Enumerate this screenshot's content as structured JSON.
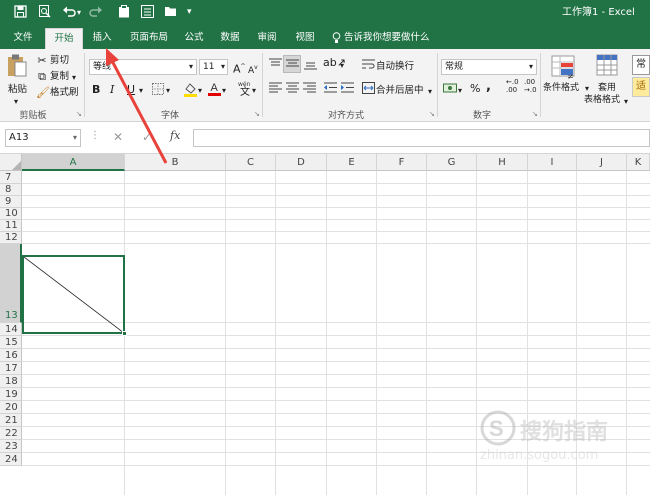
{
  "window": {
    "title": "工作簿1 - Excel"
  },
  "quick_access": {
    "save_icon": "save-icon",
    "print_preview_icon": "print-preview-icon",
    "undo_icon": "undo-icon",
    "redo_icon": "redo-icon"
  },
  "tabs": [
    "文件",
    "开始",
    "插入",
    "页面布局",
    "公式",
    "数据",
    "审阅",
    "视图"
  ],
  "active_tab": "开始",
  "tell_me": "告诉我你想要做什么",
  "clipboard": {
    "paste": "粘贴",
    "cut": "剪切",
    "copy": "复制",
    "format_painter": "格式刷",
    "group_label": "剪贴板"
  },
  "font": {
    "name": "等线",
    "size": "11",
    "group_label": "字体",
    "bold": "B",
    "italic": "I",
    "underline": "U",
    "grow": "A",
    "shrink": "A",
    "wen": "wén",
    "wen_char": "文"
  },
  "alignment": {
    "wrap_text": "自动换行",
    "merge_center": "合并后居中",
    "group_label": "对齐方式"
  },
  "number": {
    "format": "常规",
    "percent": "%",
    "comma": ",",
    "increase_decimal": "←.0 .00",
    "decrease_decimal": ".00 →.0",
    "group_label": "数字"
  },
  "styles": {
    "conditional_format": "条件格式",
    "table_format_line1": "套用",
    "table_format_line2": "表格格式",
    "normal_style": "常",
    "style_good": "适"
  },
  "formula_bar": {
    "name_box": "A13",
    "fx": "fx",
    "content": ""
  },
  "columns": [
    "A",
    "B",
    "C",
    "D",
    "E",
    "F",
    "G",
    "H",
    "I",
    "J",
    "K"
  ],
  "rows": [
    "7",
    "8",
    "9",
    "10",
    "11",
    "12",
    "13",
    "14",
    "15",
    "16",
    "17",
    "18",
    "19",
    "20",
    "21",
    "22",
    "23",
    "24"
  ],
  "selected_cell": "A13",
  "watermark": {
    "line1": "搜狗指南",
    "line2": "zhinan.sogou.com"
  },
  "colors": {
    "excel_green": "#217346",
    "annotation_red": "#e8423b",
    "header_gray": "#f0f0f0"
  }
}
